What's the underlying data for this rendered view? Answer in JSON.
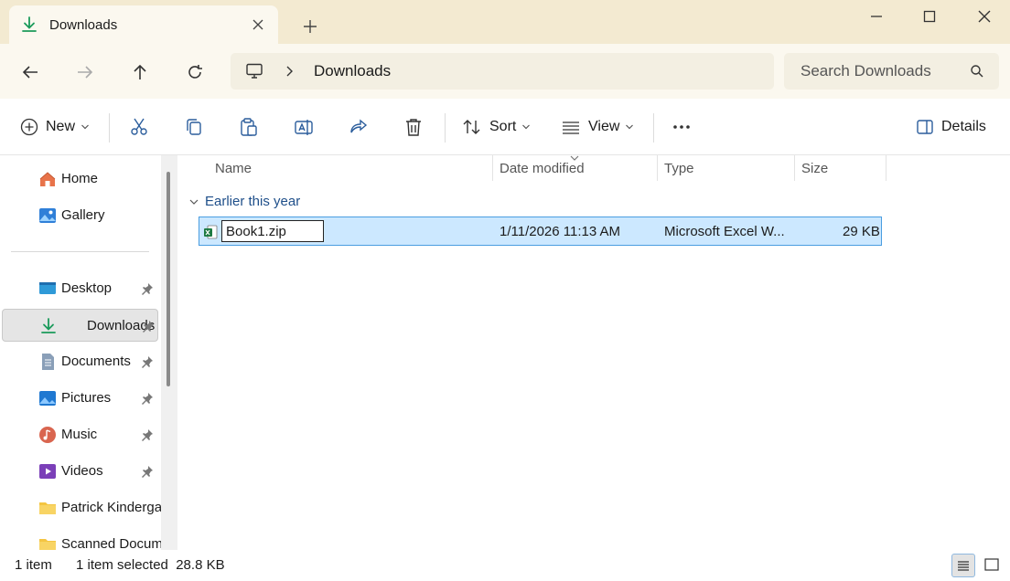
{
  "tab": {
    "title": "Downloads"
  },
  "address": {
    "crumb": "Downloads",
    "search_placeholder": "Search Downloads"
  },
  "commands": {
    "new": "New",
    "sort": "Sort",
    "view": "View",
    "details": "Details"
  },
  "sidebar": {
    "items": [
      {
        "label": "Home"
      },
      {
        "label": "Gallery"
      },
      {
        "label": "Desktop"
      },
      {
        "label": "Downloads"
      },
      {
        "label": "Documents"
      },
      {
        "label": "Pictures"
      },
      {
        "label": "Music"
      },
      {
        "label": "Videos"
      },
      {
        "label": "Patrick Kindergarten"
      },
      {
        "label": "Scanned Documents"
      }
    ]
  },
  "columns": {
    "name": "Name",
    "date": "Date modified",
    "type": "Type",
    "size": "Size"
  },
  "group": {
    "label": "Earlier this year"
  },
  "file": {
    "rename_value": "Book1.zip",
    "date": "1/11/2026 11:13 AM",
    "type": "Microsoft Excel W...",
    "size": "29 KB"
  },
  "status": {
    "count": "1 item",
    "selected": "1 item selected  28.8 KB"
  },
  "colors": {
    "accent": "#0078d4",
    "title_bg": "#f3ead1",
    "selection": "#cce8ff"
  }
}
